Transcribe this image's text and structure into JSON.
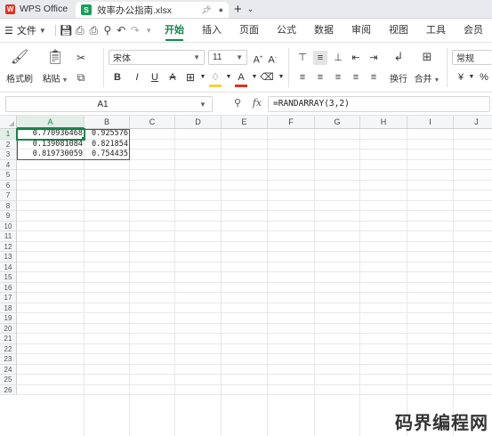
{
  "tabs": {
    "app_tab": {
      "label": "WPS Office",
      "logo_letter": "W"
    },
    "file_tab": {
      "label": "效率办公指南.xlsx",
      "icon_letter": "S"
    },
    "new_tab_glyph": "+"
  },
  "menubar": {
    "file_menu_label": "文件",
    "items": [
      "开始",
      "插入",
      "页面",
      "公式",
      "数据",
      "审阅",
      "视图",
      "工具",
      "会员"
    ],
    "active_item": "开始"
  },
  "ribbon": {
    "format_painter_label": "格式刷",
    "paste_label": "粘贴",
    "font_name": "宋体",
    "font_size": "11",
    "bold": "B",
    "italic": "I",
    "underline": "U",
    "strikethrough": "A",
    "wrap_label": "换行",
    "merge_label": "合并",
    "number_format": "常规",
    "currency_symbol": "¥",
    "percent_symbol": "%",
    "accent_color": "#18864b",
    "fill_color": "#f7d23c",
    "font_color": "#e03020"
  },
  "formula_bar": {
    "name_box": "A1",
    "fx_label": "fx",
    "formula": "=RANDARRAY(3,2)"
  },
  "sheet": {
    "columns": [
      "A",
      "B",
      "C",
      "D",
      "E",
      "F",
      "G",
      "H",
      "I",
      "J"
    ],
    "selected_column": "A",
    "rows": [
      "1",
      "2",
      "3",
      "4",
      "5",
      "6",
      "7",
      "8",
      "9",
      "10",
      "11",
      "12",
      "13",
      "14",
      "15",
      "16",
      "17",
      "18",
      "19",
      "20",
      "21",
      "22",
      "23",
      "24",
      "25",
      "26"
    ],
    "selected_row": "1",
    "cells": {
      "A1": "0.770936468",
      "B1": "0.925576",
      "A2": "0.139081084",
      "B2": "0.821854",
      "A3": "0.819730059",
      "B3": "0.754435"
    }
  },
  "watermark": "码界编程网"
}
